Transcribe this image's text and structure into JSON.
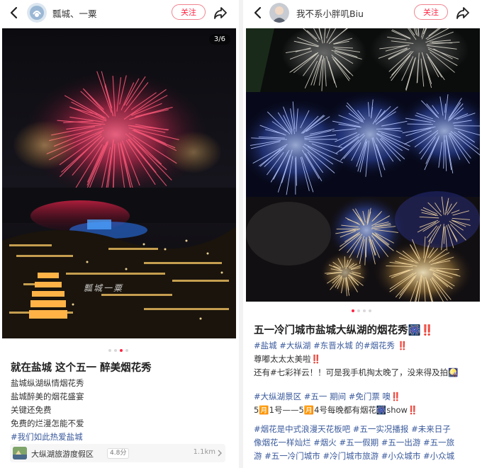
{
  "left": {
    "username": "瓢城、一粟",
    "follow_label": "关注",
    "photo_counter": "3/6",
    "watermark": "瓢城一粟",
    "title": "就在盐城 这个五一 醉美烟花秀",
    "lines": [
      "盐城纵湖纵情烟花秀",
      "盐城醉美的烟花盛宴",
      "关键还免费",
      "免费的烂漫怎能不爱",
      "#我们如此热爱盐城"
    ],
    "poi": {
      "name": "大纵湖旅游度假区",
      "score": "4.8分",
      "distance": "1.1km"
    }
  },
  "right": {
    "username": "我不系小胖叽Biu",
    "follow_label": "关注",
    "title": "五一冷门城市盐城大纵湖的烟花秀🎆‼️",
    "lines": [
      "#盐城 #大纵湖 #东晋水城 的#烟花秀 ‼️",
      "尊嘟太太太美啦‼️",
      "还有#七彩祥云！！可是我手机掏太晚了，没来得及拍🎑",
      "#大纵湖景区 #五一 期间 #免门票 噢‼️",
      "5🈷️1号——5🈷️4号每晚都有烟花🎆show‼️",
      "#烟花是中式浪漫天花板吧 #五一实况播报 #未来日子",
      "像烟花一样灿烂 #烟火 #五一假期 #五一出游 #五一旅",
      "游 #五一冷门城市 #冷门城市旅游 #小众城市 #小众城"
    ]
  },
  "colors": {
    "accent": "#ff2442",
    "tag": "#3a5a9c"
  }
}
